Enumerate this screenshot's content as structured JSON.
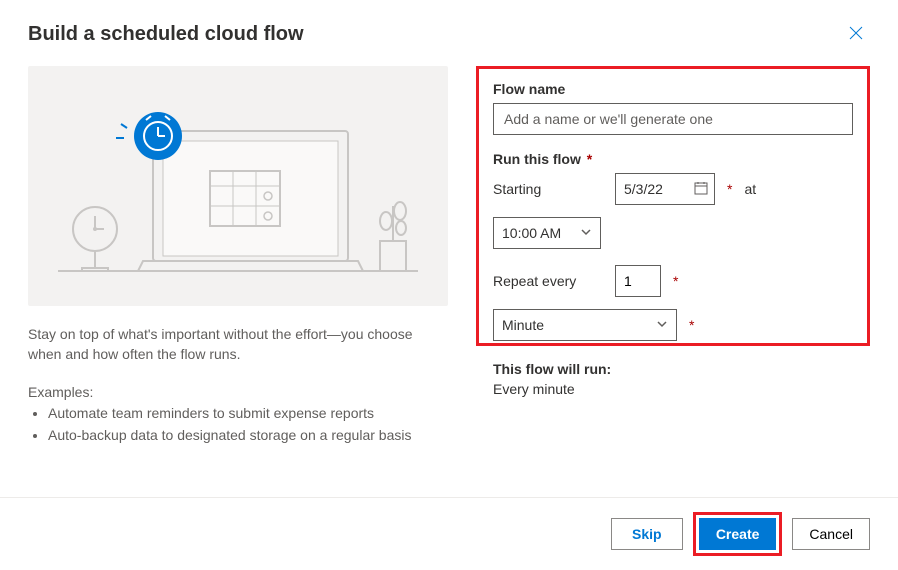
{
  "dialog": {
    "title": "Build a scheduled cloud flow",
    "description": "Stay on top of what's important without the effort—you choose when and how often the flow runs.",
    "examples_heading": "Examples:",
    "examples": [
      "Automate team reminders to submit expense reports",
      "Auto-backup data to designated storage on a regular basis"
    ]
  },
  "form": {
    "flow_name_label": "Flow name",
    "flow_name_placeholder": "Add a name or we'll generate one",
    "flow_name_value": "",
    "run_label": "Run this flow",
    "starting_label": "Starting",
    "starting_date": "5/3/22",
    "at_label": "at",
    "starting_time": "10:00 AM",
    "repeat_label": "Repeat every",
    "repeat_count": "1",
    "repeat_unit": "Minute",
    "summary_label": "This flow will run:",
    "summary_text": "Every minute"
  },
  "footer": {
    "skip": "Skip",
    "create": "Create",
    "cancel": "Cancel"
  }
}
